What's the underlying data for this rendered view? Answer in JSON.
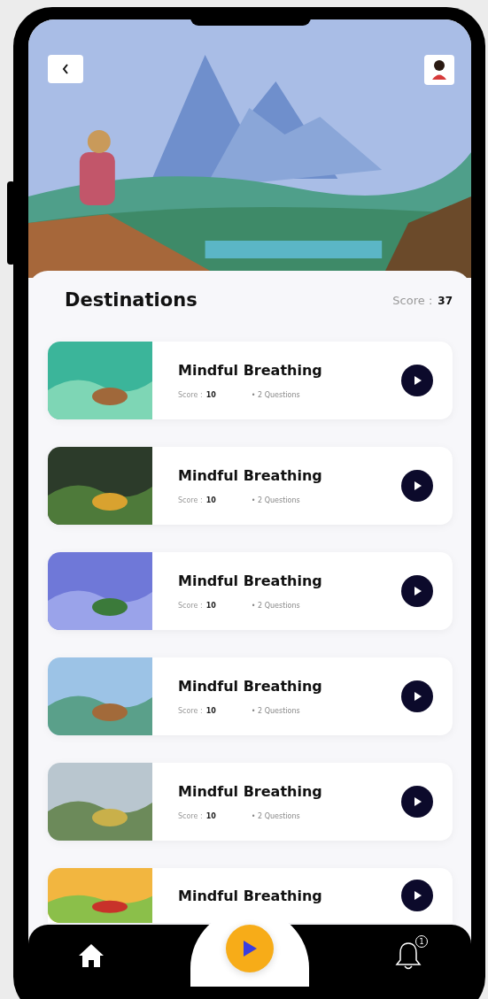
{
  "header": {
    "title": "Destinations",
    "score_label": "Score :",
    "score_value": "37"
  },
  "cards": [
    {
      "title": "Mindful Breathing",
      "score_label": "Score :",
      "score_value": "10",
      "questions": "• 2 Questions"
    },
    {
      "title": "Mindful Breathing",
      "score_label": "Score :",
      "score_value": "10",
      "questions": "• 2 Questions"
    },
    {
      "title": "Mindful Breathing",
      "score_label": "Score :",
      "score_value": "10",
      "questions": "• 2 Questions"
    },
    {
      "title": "Mindful Breathing",
      "score_label": "Score :",
      "score_value": "10",
      "questions": "• 2 Questions"
    },
    {
      "title": "Mindful Breathing",
      "score_label": "Score :",
      "score_value": "10",
      "questions": "• 2 Questions"
    },
    {
      "title": "Mindful Breathing"
    }
  ],
  "nav": {
    "notification_count": "1"
  }
}
